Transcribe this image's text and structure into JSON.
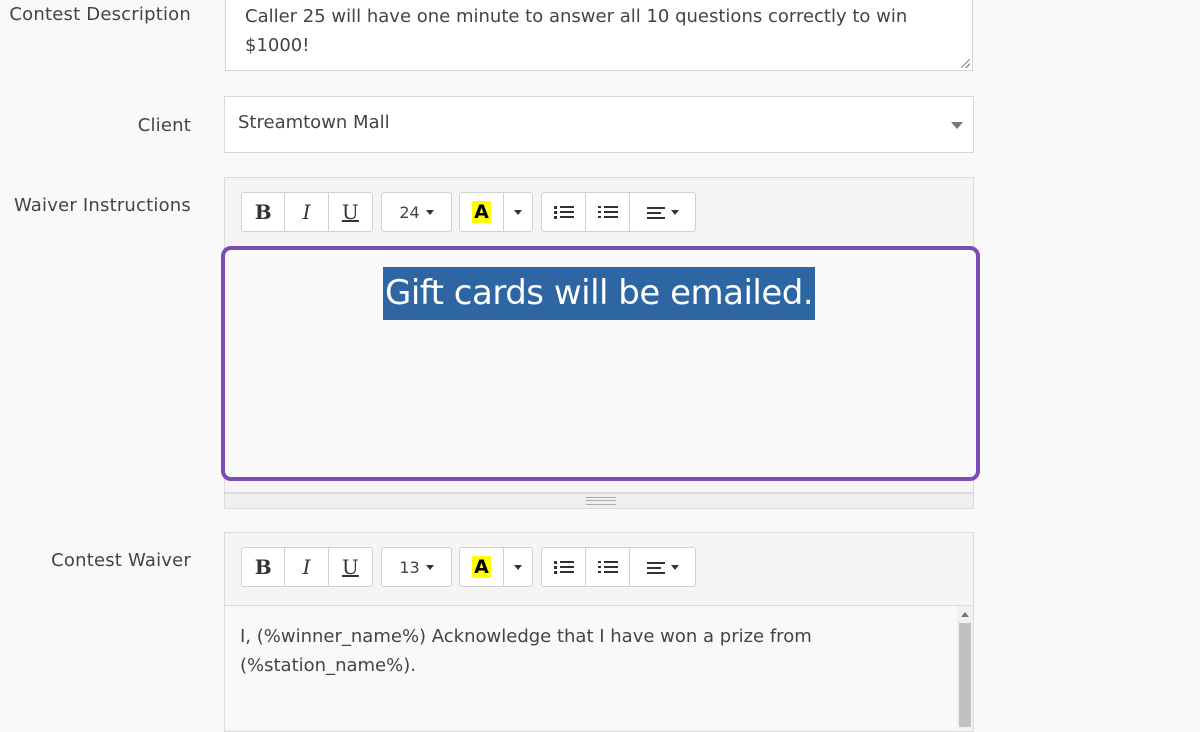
{
  "form": {
    "contest_description": {
      "label": "Contest Description",
      "value": "Caller 25 will have one minute to answer all 10 questions correctly to win $1000!"
    },
    "client": {
      "label": "Client",
      "selected": "Streamtown Mall"
    },
    "waiver_instructions": {
      "label": "Waiver Instructions",
      "font_size": "24",
      "content": "Gift cards will be emailed."
    },
    "contest_waiver": {
      "label": "Contest Waiver",
      "font_size": "13",
      "content": "I, (%winner_name%) Acknowledge that I have won a prize from (%station_name%)."
    }
  },
  "toolbar": {
    "bold": "B",
    "italic": "I",
    "underline": "U",
    "color_letter": "A"
  },
  "colors": {
    "highlight_border": "#7b4cb5",
    "selection_bg": "#2d66a3",
    "color_swatch": "#ffff00"
  }
}
